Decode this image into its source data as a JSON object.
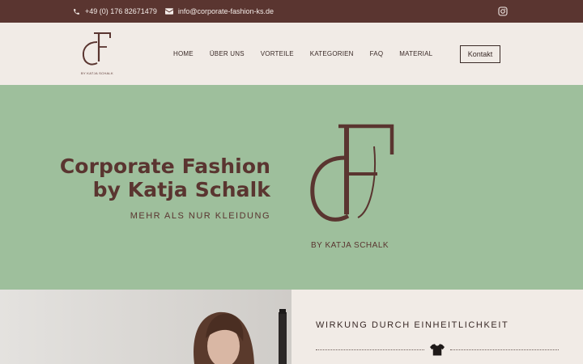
{
  "topbar": {
    "phone": "+49 (0) 176 82671479",
    "email": "info@corporate-fashion-ks.de",
    "icons": {
      "phone": "phone-icon",
      "email": "envelope-icon",
      "social": "instagram-icon"
    }
  },
  "header": {
    "logo_tagline": "BY KATJA SCHALK",
    "nav": [
      "HOME",
      "ÜBER UNS",
      "VORTEILE",
      "KATEGORIEN",
      "FAQ",
      "MATERIAL"
    ],
    "cta": "Kontakt"
  },
  "hero": {
    "title_line1": "Corporate Fashion",
    "title_line2": "by Katja Schalk",
    "subtitle": "MEHR ALS NUR KLEIDUNG",
    "logo_tagline": "BY KATJA SCHALK"
  },
  "section": {
    "title": "WIRKUNG DURCH EINHEITLICHKEIT",
    "icon": "tshirt-icon"
  },
  "colors": {
    "brand_brown": "#5a3530",
    "hero_green": "#9ebf9c",
    "background": "#f1ebe6"
  }
}
